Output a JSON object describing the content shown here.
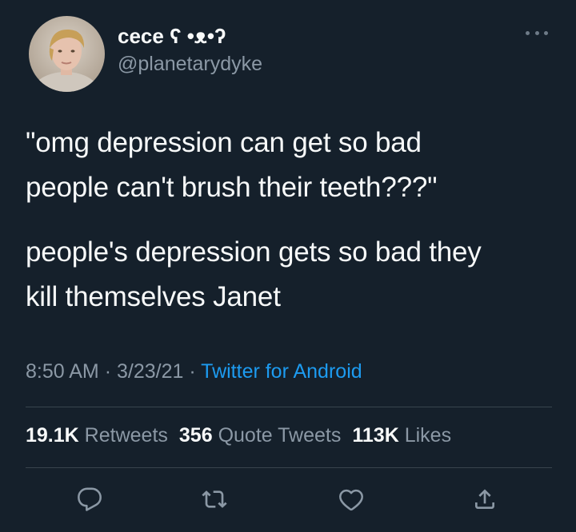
{
  "author": {
    "display_name": "cece ʕ •ᴥ•ʔ",
    "handle": "@planetarydyke",
    "avatar_icon": "profile-photo"
  },
  "tweet": {
    "paragraphs": [
      "\"omg depression can get so bad people can't brush their teeth???\"",
      "people's depression gets so bad they kill themselves Janet"
    ],
    "time": "8:50 AM",
    "separator": "·",
    "date": "3/23/21",
    "source": "Twitter for Android"
  },
  "stats": {
    "retweets_count": "19.1K",
    "retweets_label": "Retweets",
    "quotes_count": "356",
    "quotes_label": "Quote Tweets",
    "likes_count": "113K",
    "likes_label": "Likes"
  },
  "actions": {
    "reply_icon": "speech-bubble-icon",
    "retweet_icon": "retweet-arrows-icon",
    "like_icon": "heart-icon",
    "share_icon": "share-upload-icon"
  },
  "colors": {
    "background": "#15202b",
    "text": "#f7f9f9",
    "secondary_text": "#8b98a5",
    "link": "#1d9bf0",
    "divider": "#38444d"
  }
}
